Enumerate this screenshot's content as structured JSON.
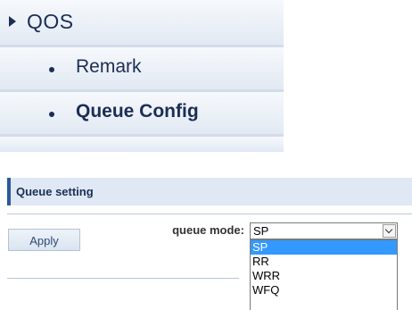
{
  "menu": {
    "section": {
      "label": "QOS",
      "icon": "arrow-right-icon"
    },
    "items": [
      {
        "label": "Remark",
        "icon": "bullet-icon",
        "active": false
      },
      {
        "label": "Queue Config",
        "icon": "bullet-icon",
        "active": true
      }
    ],
    "colors": {
      "text": "#1b2e55",
      "bg": "#e7edf6"
    }
  },
  "panel": {
    "title": "Queue setting",
    "field_label": "queue mode:",
    "select": {
      "value": "SP",
      "options": [
        "SP",
        "RR",
        "WRR",
        "WFQ"
      ],
      "highlighted": "SP",
      "open": true
    },
    "apply_label": "Apply",
    "colors": {
      "header_bg": "#dfe8f4",
      "accent": "#2c5a9a",
      "highlight": "#3399ff"
    }
  }
}
